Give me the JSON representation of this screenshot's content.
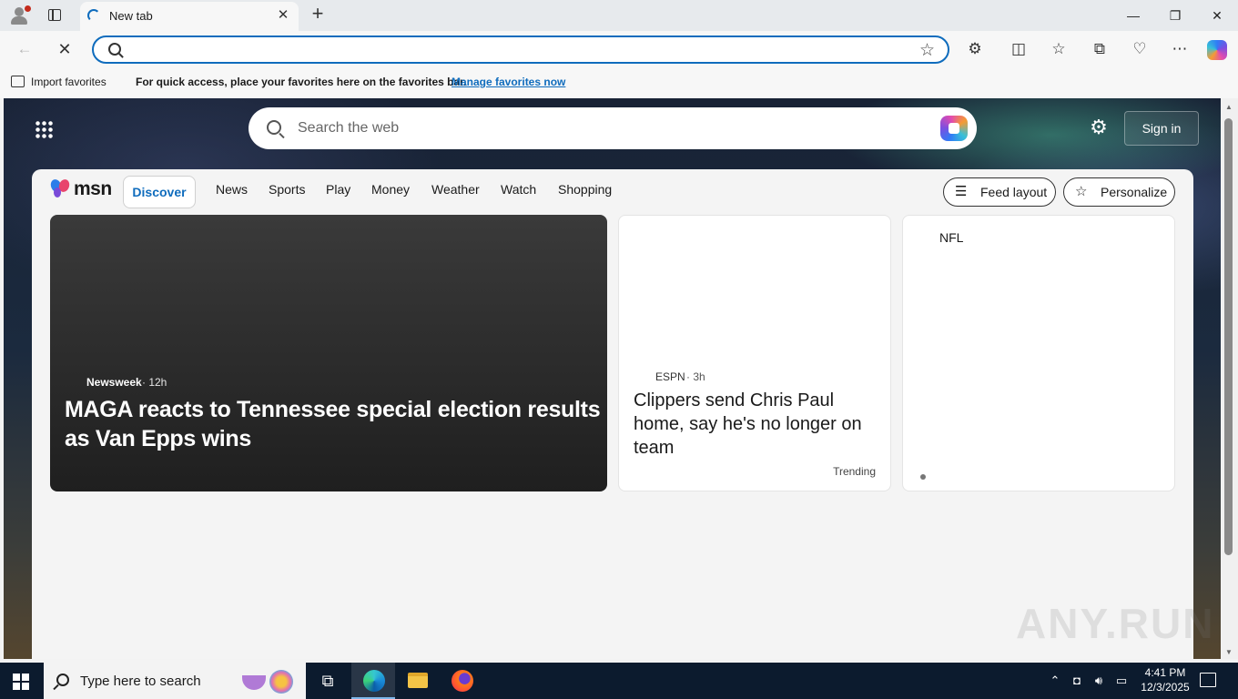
{
  "browser": {
    "tab_title": "New tab",
    "address_value": "",
    "address_placeholder": "",
    "icons": [
      "profile-icon",
      "tab-actions-icon",
      "close-icon",
      "plus-icon",
      "back-icon",
      "stop-icon",
      "search-icon",
      "star-icon",
      "extensions-icon",
      "split-screen-icon",
      "favorites-icon",
      "collections-icon",
      "browser-essentials-icon",
      "more-icon",
      "copilot-icon"
    ]
  },
  "favorites_bar": {
    "import_label": "Import favorites",
    "hint": "For quick access, place your favorites here on the favorites bar.",
    "manage_link": "Manage favorites now"
  },
  "msn": {
    "search_placeholder": "Search the web",
    "sign_in": "Sign in",
    "logo_text": "msn",
    "nav": [
      "Discover",
      "News",
      "Sports",
      "Play",
      "Money",
      "Weather",
      "Watch",
      "Shopping"
    ],
    "active_nav": "Discover",
    "feed_layout_label": "Feed layout",
    "personalize_label": "Personalize",
    "cards": {
      "hero": {
        "source": "Newsweek",
        "age": "· 12h",
        "headline": "MAGA reacts to Tennessee special election results as Van Epps wins"
      },
      "mid": {
        "source": "ESPN",
        "age": "· 3h",
        "headline": "Clippers send Chris Paul home, say he's no longer on team",
        "tag": "Trending"
      },
      "right": {
        "label": "NFL"
      }
    },
    "watermark": "ANY.RUN"
  },
  "taskbar": {
    "search_text": "Type here to search",
    "time": "4:41 PM",
    "date": "12/3/2025"
  },
  "colors": {
    "accent": "#0f6cbd",
    "taskbar": "#0c1b2e"
  }
}
